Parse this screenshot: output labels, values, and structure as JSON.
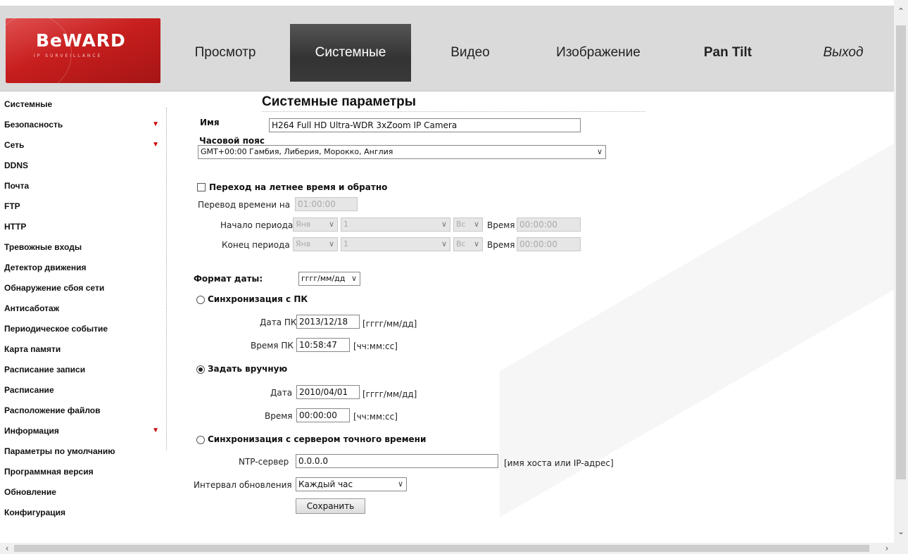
{
  "brand": {
    "logo_text": "BeWARD",
    "logo_sub": "IP SURVEILLANCE"
  },
  "nav": [
    {
      "label": "Просмотр"
    },
    {
      "label": "Системные"
    },
    {
      "label": "Видео"
    },
    {
      "label": "Изображение"
    },
    {
      "label": "Pan Tilt"
    },
    {
      "label": "Выход"
    }
  ],
  "sidebar": [
    {
      "label": "Системные"
    },
    {
      "label": "Безопасность",
      "expand": "▼"
    },
    {
      "label": "Сеть",
      "expand": "▼"
    },
    {
      "label": "DDNS"
    },
    {
      "label": "Почта"
    },
    {
      "label": "FTP"
    },
    {
      "label": "HTTP"
    },
    {
      "label": "Тревожные входы"
    },
    {
      "label": "Детектор движения"
    },
    {
      "label": "Обнаружение сбоя сети"
    },
    {
      "label": "Антисаботаж"
    },
    {
      "label": "Периодическое событие"
    },
    {
      "label": "Карта памяти"
    },
    {
      "label": "Расписание записи"
    },
    {
      "label": "Расписание"
    },
    {
      "label": "Расположение файлов"
    },
    {
      "label": "Информация",
      "expand": "▼"
    },
    {
      "label": "Параметры по умолчанию"
    },
    {
      "label": "Программная версия"
    },
    {
      "label": "Обновление"
    },
    {
      "label": "Конфигурация"
    }
  ],
  "page": {
    "title": "Системные параметры"
  },
  "name": {
    "label": "Имя",
    "value": "H264 Full HD Ultra-WDR 3xZoom IP Camera"
  },
  "timezone": {
    "label": "Часовой пояс",
    "value": "GMT+00:00 Гамбия, Либерия, Морокко, Англия"
  },
  "dst": {
    "label": "Переход на летнее время и обратно",
    "checked": false,
    "shift_label": "Перевод времени на",
    "shift_value": "01:00:00",
    "start": {
      "label": "Начало периода",
      "month": "Янв",
      "week": "1",
      "day": "Вс",
      "time_label": "Время",
      "time": "00:00:00"
    },
    "end": {
      "label": "Конец периода",
      "month": "Янв",
      "week": "1",
      "day": "Вс",
      "time_label": "Время",
      "time": "00:00:00"
    }
  },
  "date_format": {
    "label": "Формат даты:",
    "value": "гггг/мм/дд"
  },
  "sync_pc": {
    "label": "Синхронизация с ПК",
    "date_label": "Дата ПК",
    "date_value": "2013/12/18",
    "date_hint": "[гггг/мм/дд]",
    "time_label": "Время ПК",
    "time_value": "10:58:47",
    "time_hint": "[чч:мм:сс]"
  },
  "manual": {
    "label": "Задать вручную",
    "selected": true,
    "date_label": "Дата",
    "date_value": "2010/04/01",
    "date_hint": "[гггг/мм/дд]",
    "time_label": "Время",
    "time_value": "00:00:00",
    "time_hint": "[чч:мм:сс]"
  },
  "ntp": {
    "label": "Синхронизация с сервером точного времени",
    "server_label": "NTP-сервер",
    "server_value": "0.0.0.0",
    "server_hint": "[имя хоста или IP-адрес]",
    "interval_label": "Интервал обновления",
    "interval_value": "Каждый час"
  },
  "save_label": "Сохранить"
}
